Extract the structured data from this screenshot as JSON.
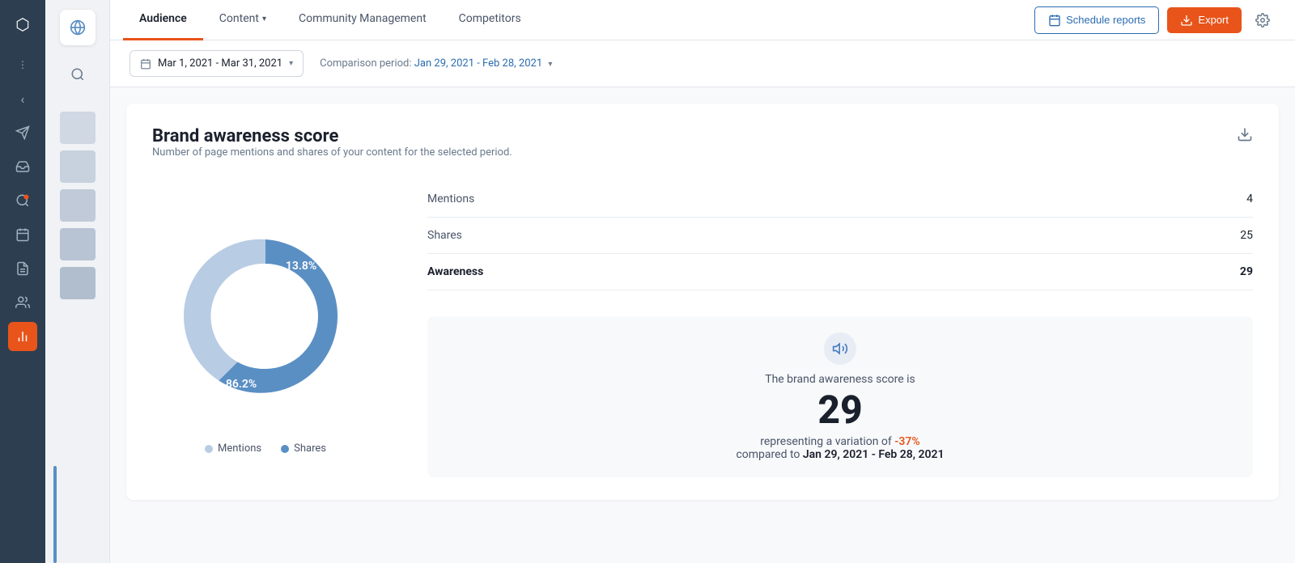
{
  "sidebar_dark": {
    "icons": [
      {
        "name": "logo-icon",
        "symbol": "⬡",
        "active": false,
        "label": "logo"
      },
      {
        "name": "dots-icon",
        "symbol": "⋮",
        "active": false,
        "label": "more"
      },
      {
        "name": "back-icon",
        "symbol": "›",
        "active": false,
        "label": "back"
      },
      {
        "name": "paper-plane-icon",
        "symbol": "✈",
        "active": false,
        "label": "send"
      },
      {
        "name": "inbox-icon",
        "symbol": "📥",
        "active": false,
        "label": "inbox"
      },
      {
        "name": "search-notify-icon",
        "symbol": "🔍",
        "active": false,
        "label": "search-notify"
      },
      {
        "name": "calendar-icon",
        "symbol": "📅",
        "active": false,
        "label": "calendar"
      },
      {
        "name": "report-icon",
        "symbol": "📋",
        "active": false,
        "label": "report"
      },
      {
        "name": "people-icon",
        "symbol": "👥",
        "active": false,
        "label": "people"
      },
      {
        "name": "analytics-icon",
        "symbol": "📊",
        "active": true,
        "label": "analytics"
      }
    ]
  },
  "sidebar_light": {
    "icons": [
      {
        "name": "sidebar-top-icon",
        "symbol": "⊞",
        "active": true
      },
      {
        "name": "sidebar-search-icon",
        "symbol": "🔍",
        "active": false
      }
    ]
  },
  "topnav": {
    "tabs": [
      {
        "id": "audience",
        "label": "Audience",
        "active": true,
        "has_chevron": false
      },
      {
        "id": "content",
        "label": "Content",
        "active": false,
        "has_chevron": true
      },
      {
        "id": "community",
        "label": "Community Management",
        "active": false,
        "has_chevron": false
      },
      {
        "id": "competitors",
        "label": "Competitors",
        "active": false,
        "has_chevron": false
      }
    ],
    "schedule_btn": "Schedule reports",
    "export_btn": "Export",
    "gear_symbol": "⚙"
  },
  "filterbar": {
    "date_icon": "📅",
    "date_range": "Mar 1, 2021 - Mar 31, 2021",
    "date_chevron": "▾",
    "comparison_label": "Comparison period:",
    "comparison_range": "Jan 29, 2021 - Feb 28, 2021",
    "comparison_chevron": "▾"
  },
  "card": {
    "title": "Brand awareness score",
    "subtitle": "Number of page mentions and shares of your content for the selected period.",
    "download_icon": "⬇"
  },
  "chart": {
    "mentions_pct": 13.8,
    "shares_pct": 86.2,
    "mentions_label": "13.8%",
    "shares_label": "86.2%",
    "color_mentions": "#b8cce4",
    "color_shares": "#5a8fc4"
  },
  "stats": {
    "rows": [
      {
        "label": "Mentions",
        "value": "4",
        "bold": false
      },
      {
        "label": "Shares",
        "value": "25",
        "bold": false
      },
      {
        "label": "Awareness",
        "value": "29",
        "bold": true
      }
    ]
  },
  "awareness_box": {
    "icon_symbol": "📢",
    "description": "The brand awareness score is",
    "score": "29",
    "variation_prefix": "representing a variation of",
    "variation_value": "-37%",
    "period_prefix": "compared to",
    "period": "Jan 29, 2021 - Feb 28, 2021"
  },
  "legend": {
    "items": [
      {
        "label": "Mentions",
        "color": "#b8cce4"
      },
      {
        "label": "Shares",
        "color": "#5a8fc4"
      }
    ]
  }
}
